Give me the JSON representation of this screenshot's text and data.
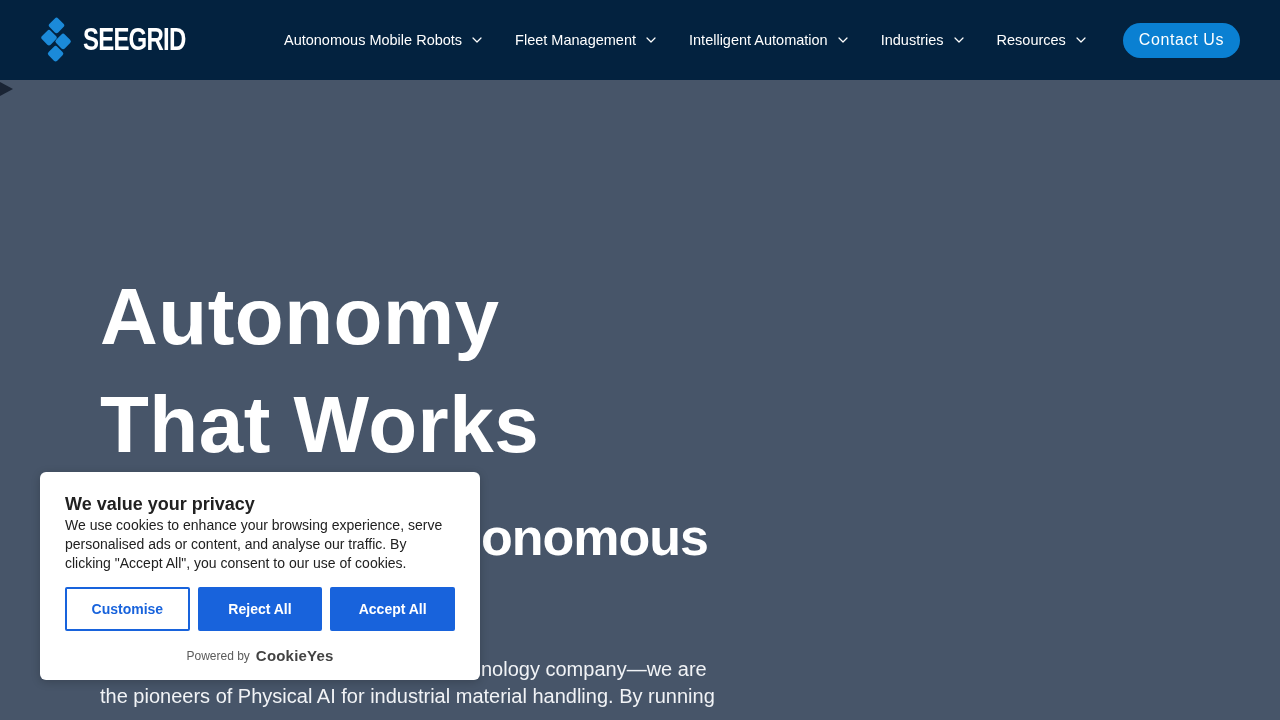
{
  "nav": {
    "logo": {
      "wordmark": "SEEGRID"
    },
    "menu": [
      {
        "label": "Autonomous Mobile Robots",
        "dropdown": true
      },
      {
        "label": "Fleet Management",
        "dropdown": true
      },
      {
        "label": "Intelligent Automation",
        "dropdown": true
      },
      {
        "label": "Industries",
        "dropdown": true
      },
      {
        "label": "Resources",
        "dropdown": true
      }
    ],
    "cta": "Contact Us"
  },
  "hero": {
    "title_lines": [
      "Autonomy",
      "That Works"
    ],
    "subtitle_visible": "onomous",
    "intro_lines": [
      "nology company—we are",
      "the pioneers of Physical AI for industrial material handling. By running"
    ]
  },
  "cookie_banner": {
    "title": "We value your privacy",
    "text": "We use cookies to enhance your browsing experience, serve personalised ads or content, and analyse our traffic. By clicking \"Accept All\", you consent to our use of cookies.",
    "buttons": [
      {
        "label": "Customise",
        "kind": "outline"
      },
      {
        "label": "Reject All",
        "kind": "filled"
      },
      {
        "label": "Accept All",
        "kind": "filled"
      }
    ],
    "powered_by": "Powered by",
    "brand": "CookieYes"
  }
}
